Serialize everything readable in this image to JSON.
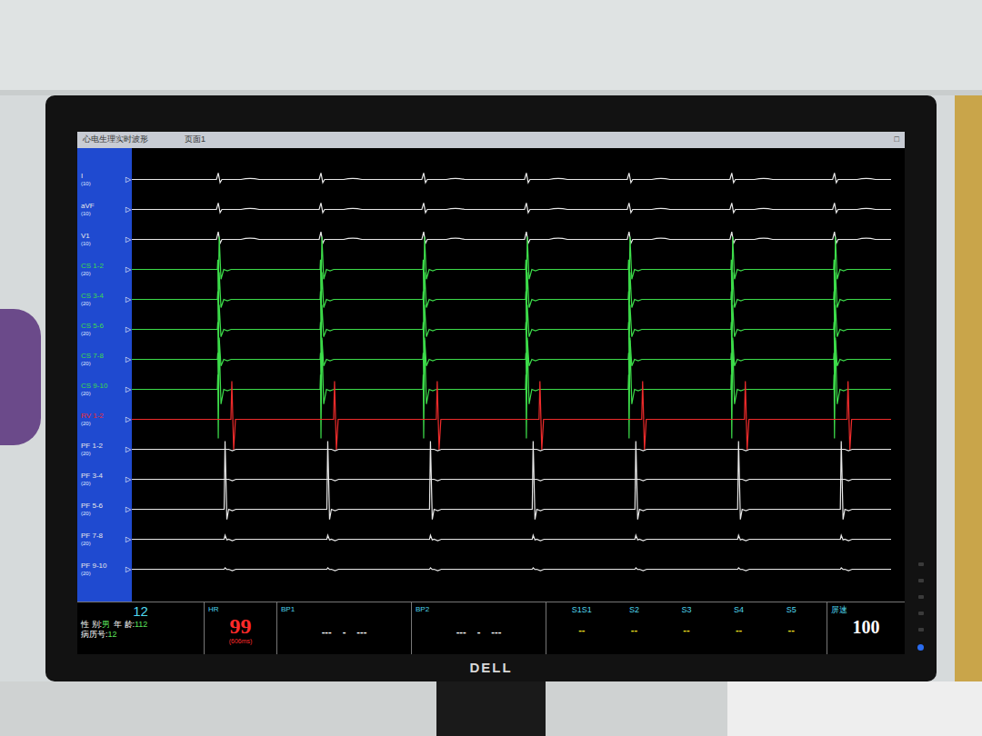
{
  "window": {
    "title": "心电生理实时波形",
    "page": "页面1",
    "control": "□"
  },
  "recording": {
    "window_ms": 4480,
    "beats_ms": [
      510,
      1116,
      1722,
      2328,
      2934,
      3540,
      4146
    ],
    "marker": "▷"
  },
  "channels": [
    {
      "name": "I",
      "gain": "(10)",
      "kind": "surface",
      "color": "#e8e8e8",
      "amplitude": 0.3,
      "delay_ms": 0
    },
    {
      "name": "aVF",
      "gain": "(10)",
      "kind": "surface",
      "color": "#e8e8e8",
      "amplitude": 0.3,
      "delay_ms": 0
    },
    {
      "name": "V1",
      "gain": "(10)",
      "kind": "surface",
      "color": "#e8e8e8",
      "amplitude": 0.35,
      "delay_ms": 0
    },
    {
      "name": "CS 1-2",
      "gain": "(20)",
      "kind": "cs",
      "color": "#3ddc4a",
      "amplitude": 1.2,
      "delay_ms": 0
    },
    {
      "name": "CS 3-4",
      "gain": "(20)",
      "kind": "cs",
      "color": "#3ddc4a",
      "amplitude": 1.0,
      "delay_ms": 0
    },
    {
      "name": "CS 5-6",
      "gain": "(20)",
      "kind": "cs",
      "color": "#3ddc4a",
      "amplitude": 0.9,
      "delay_ms": 0
    },
    {
      "name": "CS 7-8",
      "gain": "(20)",
      "kind": "cs",
      "color": "#3ddc4a",
      "amplitude": 0.8,
      "delay_ms": 0
    },
    {
      "name": "CS 9-10",
      "gain": "(20)",
      "kind": "cs",
      "color": "#3ddc4a",
      "amplitude": 1.8,
      "delay_ms": 0
    },
    {
      "name": "RV 1-2",
      "gain": "(20)",
      "kind": "rv",
      "color": "#ef2b2b",
      "amplitude": 1.4,
      "delay_ms": 80
    },
    {
      "name": "PF 1-2",
      "gain": "(20)",
      "kind": "pf",
      "color": "#e8e8e8",
      "amplitude": 0,
      "delay_ms": 40
    },
    {
      "name": "PF 3-4",
      "gain": "(20)",
      "kind": "pf",
      "color": "#e8e8e8",
      "amplitude": 0,
      "delay_ms": 40
    },
    {
      "name": "PF 5-6",
      "gain": "(20)",
      "kind": "pf",
      "color": "#e8e8e8",
      "amplitude": 2.5,
      "delay_ms": 40
    },
    {
      "name": "PF 7-8",
      "gain": "(20)",
      "kind": "pf",
      "color": "#e8e8e8",
      "amplitude": 0.15,
      "delay_ms": 40
    },
    {
      "name": "PF 9-10",
      "gain": "(20)",
      "kind": "pf",
      "color": "#e8e8e8",
      "amplitude": 0.05,
      "delay_ms": 40
    }
  ],
  "patient": {
    "id": "12",
    "fields": [
      {
        "label": "性 别:",
        "value": "男"
      },
      {
        "label": "年 龄:",
        "value": "112"
      }
    ],
    "record": {
      "label": "病历号:",
      "value": "12"
    }
  },
  "hr": {
    "label": "HR",
    "value": "99",
    "interval": "(606ms)"
  },
  "bp": [
    {
      "label": "BP1",
      "values": [
        "---",
        "-",
        "---"
      ]
    },
    {
      "label": "BP2",
      "values": [
        "---",
        "-",
        "---"
      ]
    }
  ],
  "stim": [
    {
      "label": "S1S1",
      "value": "--"
    },
    {
      "label": "S2",
      "value": "--"
    },
    {
      "label": "S3",
      "value": "--"
    },
    {
      "label": "S4",
      "value": "--"
    },
    {
      "label": "S5",
      "value": "--"
    }
  ],
  "speed": {
    "label": "屏速",
    "value": "100"
  },
  "brand": "DELL"
}
